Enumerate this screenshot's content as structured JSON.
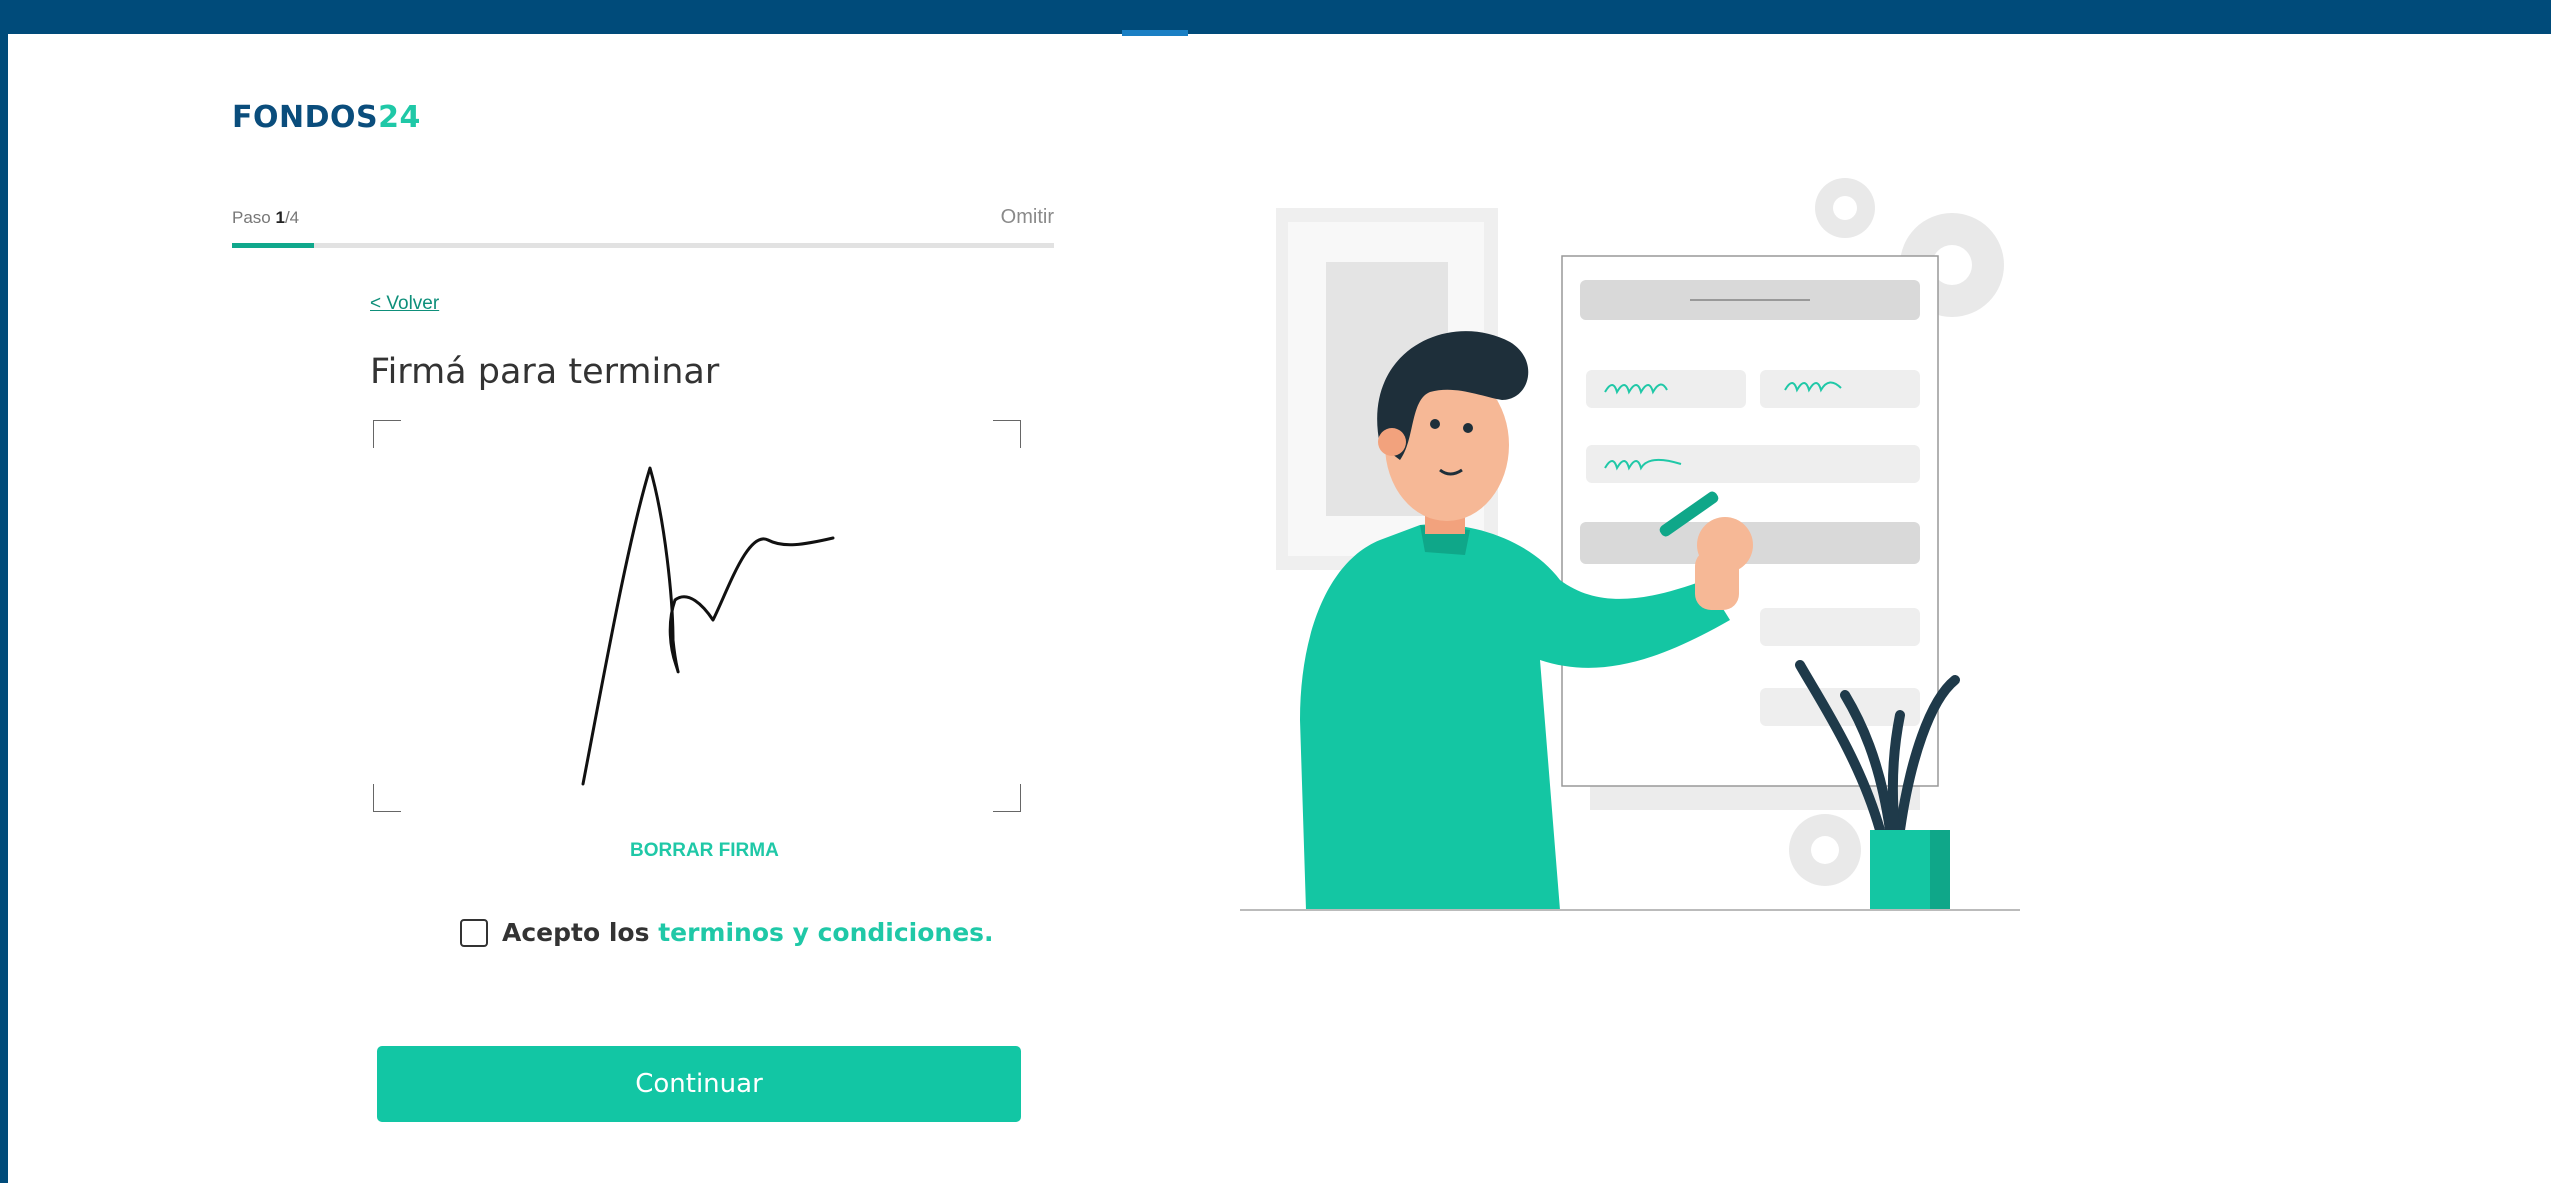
{
  "brand": {
    "name": "FONDOS",
    "number": "24"
  },
  "progress": {
    "step_prefix": "Paso ",
    "step_current": "1",
    "step_total": "/4",
    "fraction": 0.1,
    "skip_label": "Omitir"
  },
  "form": {
    "back_label": "< Volver",
    "title": "Firmá para terminar",
    "clear_label": "BORRAR FIRMA",
    "terms_prefix": "Acepto los ",
    "terms_link": "terminos y condiciones.",
    "terms_checked": false,
    "continue_label": "Continuar"
  },
  "colors": {
    "header_bar": "#004b7a",
    "accent": "#12c6a4",
    "progress": "#10a88c",
    "brand_blue": "#0a4d7c"
  },
  "illustration": {
    "icon": "man-signing-document-illustration"
  }
}
